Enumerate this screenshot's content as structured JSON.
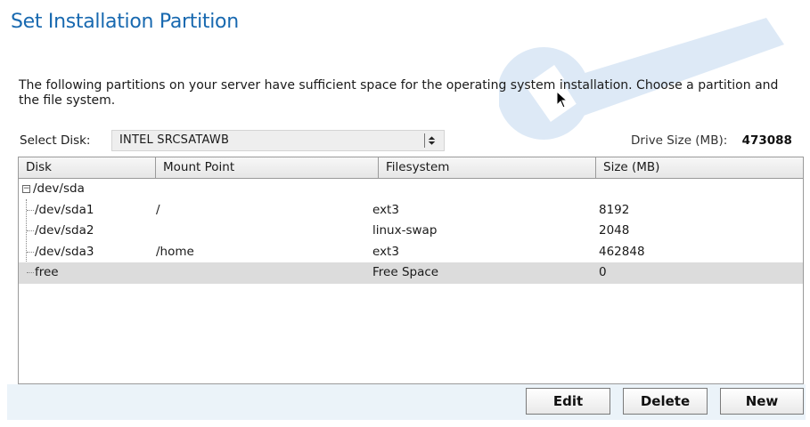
{
  "title": "Set Installation Partition",
  "description": "The following partitions on your server have sufficient space for the operating system installation. Choose a partition and the file system.",
  "select_disk": {
    "label": "Select Disk:",
    "value": "INTEL SRCSATAWB"
  },
  "drive_size": {
    "label": "Drive Size (MB):",
    "value": "473088"
  },
  "table": {
    "columns": [
      "Disk",
      "Mount Point",
      "Filesystem",
      "Size (MB)"
    ],
    "root": {
      "disk": "/dev/sda",
      "expanded": true
    },
    "rows": [
      {
        "disk": "/dev/sda1",
        "mount": "/",
        "filesystem": "ext3",
        "size": "8192",
        "selected": false
      },
      {
        "disk": "/dev/sda2",
        "mount": "",
        "filesystem": "linux-swap",
        "size": "2048",
        "selected": false
      },
      {
        "disk": "/dev/sda3",
        "mount": "/home",
        "filesystem": "ext3",
        "size": "462848",
        "selected": false
      },
      {
        "disk": "free",
        "mount": "",
        "filesystem": "Free Space",
        "size": "0",
        "selected": true
      }
    ]
  },
  "buttons": {
    "edit": "Edit",
    "delete": "Delete",
    "new": "New"
  },
  "colors": {
    "title": "#1869b0",
    "selected_row": "#dcdcdc",
    "bottom_bar": "#ebf3f9"
  }
}
